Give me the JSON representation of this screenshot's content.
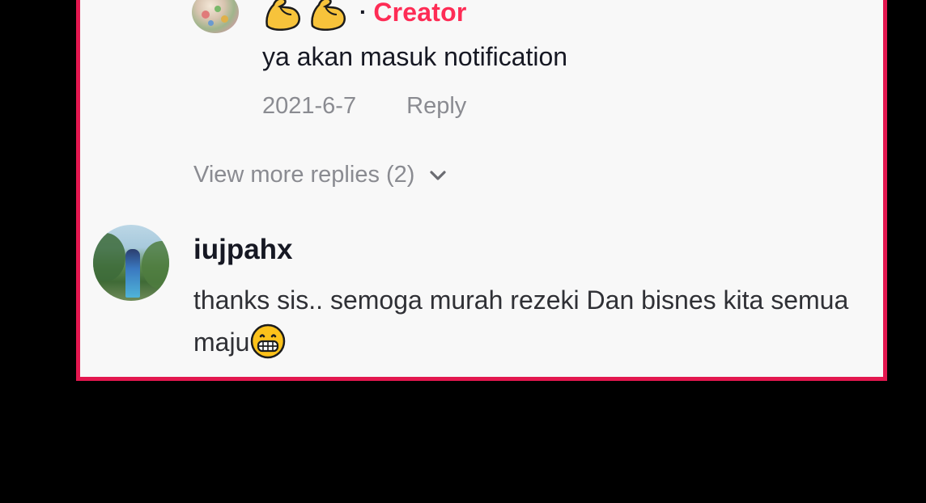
{
  "reply": {
    "badge_separator": "·",
    "badge_label": "Creator",
    "text": "ya akan masuk notification",
    "date": "2021-6-7",
    "reply_label": "Reply"
  },
  "view_more": {
    "label": "View more replies (2)"
  },
  "comment": {
    "username": "iujpahx",
    "text": "thanks sis.. semoga murah rezeki Dan bisnes kita semua maju"
  },
  "colors": {
    "border": "#e3174f",
    "creator": "#fe2c55",
    "muted": "#8a8b91",
    "panel": "#f8f8f8"
  },
  "icons": {
    "header_emoji": "flexed-biceps-icon",
    "expand": "chevron-down-icon",
    "comment_emoji": "grinning-face-icon"
  }
}
